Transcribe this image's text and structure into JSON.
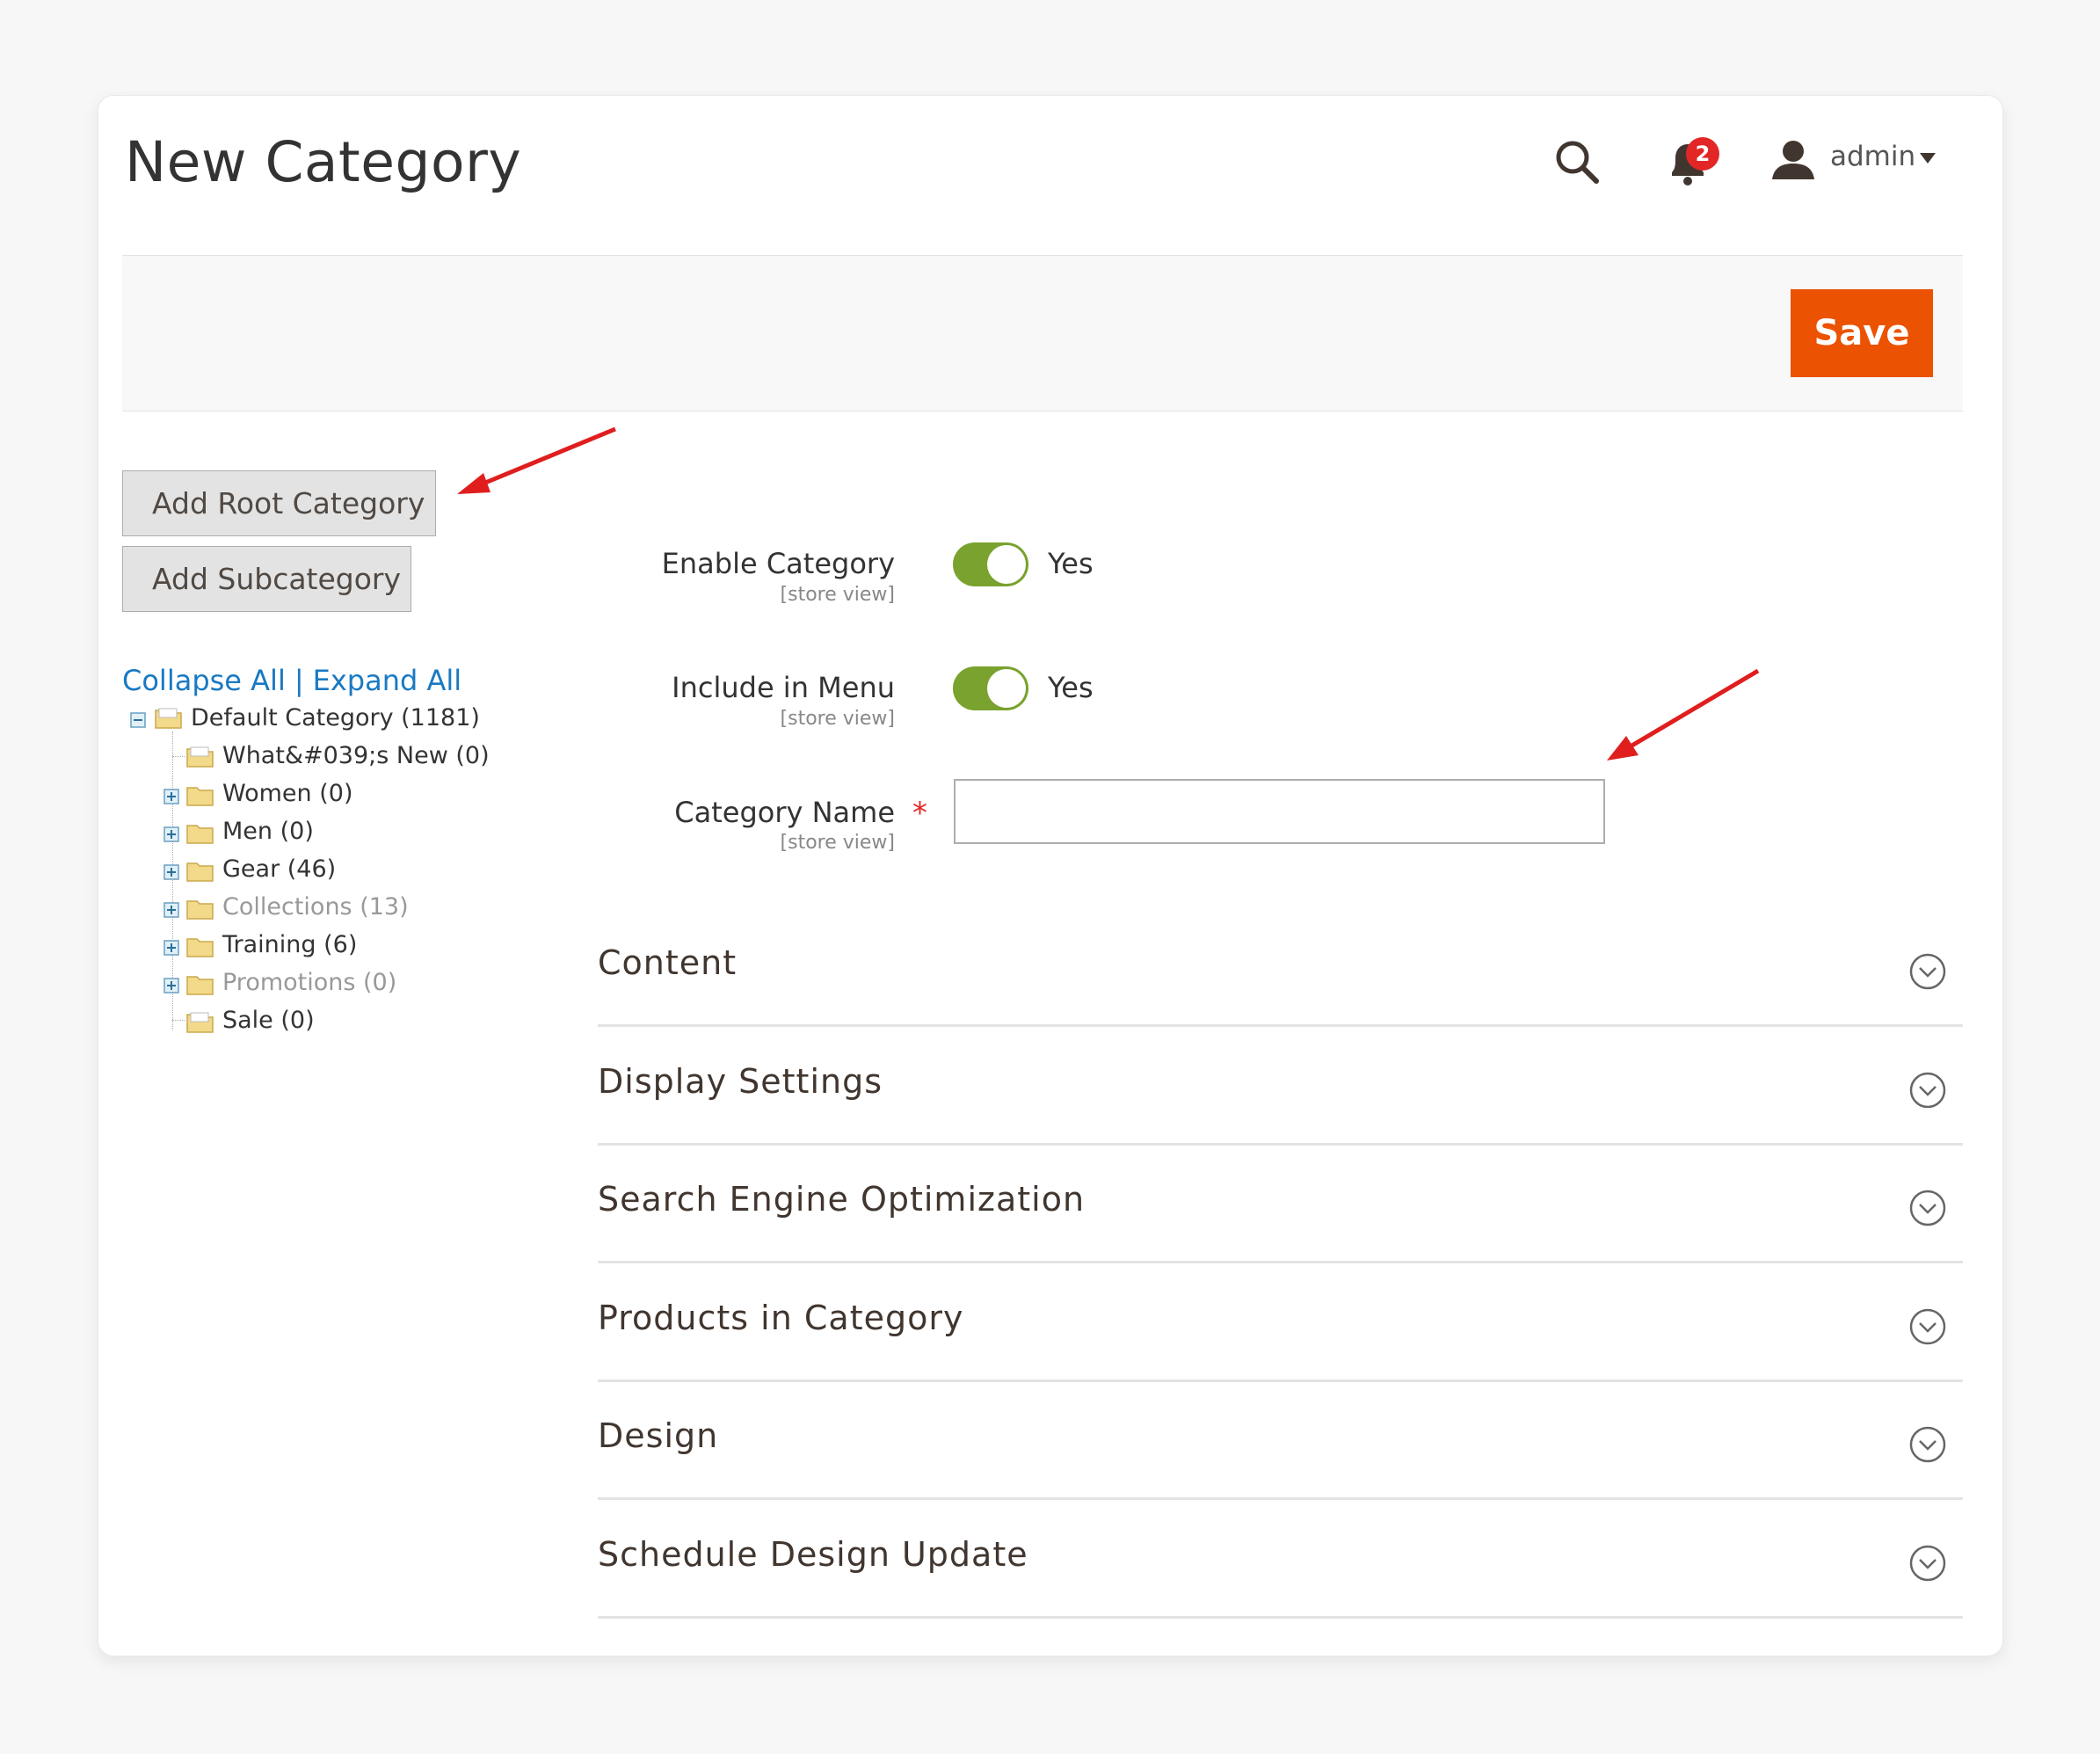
{
  "header": {
    "title": "New Category",
    "notification_count": "2",
    "user_label": "admin"
  },
  "actions": {
    "save_label": "Save"
  },
  "sidebar": {
    "add_root_label": "Add Root Category",
    "add_sub_label": "Add Subcategory",
    "collapse_all": "Collapse All",
    "separator": "|",
    "expand_all": "Expand All",
    "tree": {
      "root": "Default Category (1181)",
      "children": [
        {
          "label": "What&#039;s New (0)",
          "expandable": false,
          "muted": false
        },
        {
          "label": "Women (0)",
          "expandable": true,
          "muted": false
        },
        {
          "label": "Men (0)",
          "expandable": true,
          "muted": false
        },
        {
          "label": "Gear (46)",
          "expandable": true,
          "muted": false
        },
        {
          "label": "Collections (13)",
          "expandable": true,
          "muted": true
        },
        {
          "label": "Training (6)",
          "expandable": true,
          "muted": false
        },
        {
          "label": "Promotions (0)",
          "expandable": true,
          "muted": true
        },
        {
          "label": "Sale (0)",
          "expandable": false,
          "muted": false
        }
      ]
    }
  },
  "form": {
    "enable_category": {
      "label": "Enable Category",
      "scope": "[store view]",
      "value": "Yes"
    },
    "include_in_menu": {
      "label": "Include in Menu",
      "scope": "[store view]",
      "value": "Yes"
    },
    "category_name": {
      "label": "Category Name",
      "scope": "[store view]",
      "required": "*",
      "value": ""
    }
  },
  "sections": [
    {
      "title": "Content"
    },
    {
      "title": "Display Settings"
    },
    {
      "title": "Search Engine Optimization"
    },
    {
      "title": "Products in Category"
    },
    {
      "title": "Design"
    },
    {
      "title": "Schedule Design Update"
    }
  ],
  "colors": {
    "accent": "#eb5202",
    "toggle_on": "#79a22e",
    "link": "#1979c3",
    "badge": "#e22626",
    "annotation_arrow": "#e01e1e"
  }
}
